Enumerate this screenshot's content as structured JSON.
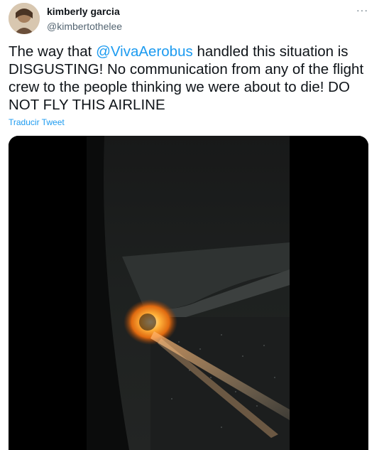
{
  "user": {
    "display_name": "kimberly garcia",
    "handle": "@kimbertothelee"
  },
  "tweet": {
    "text_before": "The way that ",
    "mention": "@VivaAerobus",
    "text_after": " handled this situation is DISGUSTING! No communication from any of the flight crew to the people thinking we were about to die! DO NOT FLY THIS AIRLINE",
    "translate_label": "Traducir Tweet"
  },
  "more_label": "···",
  "media": {
    "icon": "video-frame",
    "colors": {
      "fire": "#ff8a1c",
      "night_sky": "#1b1d1c",
      "frame": "#000000"
    }
  },
  "colors": {
    "accent": "#1d9bf0",
    "secondary_text": "#536471"
  }
}
